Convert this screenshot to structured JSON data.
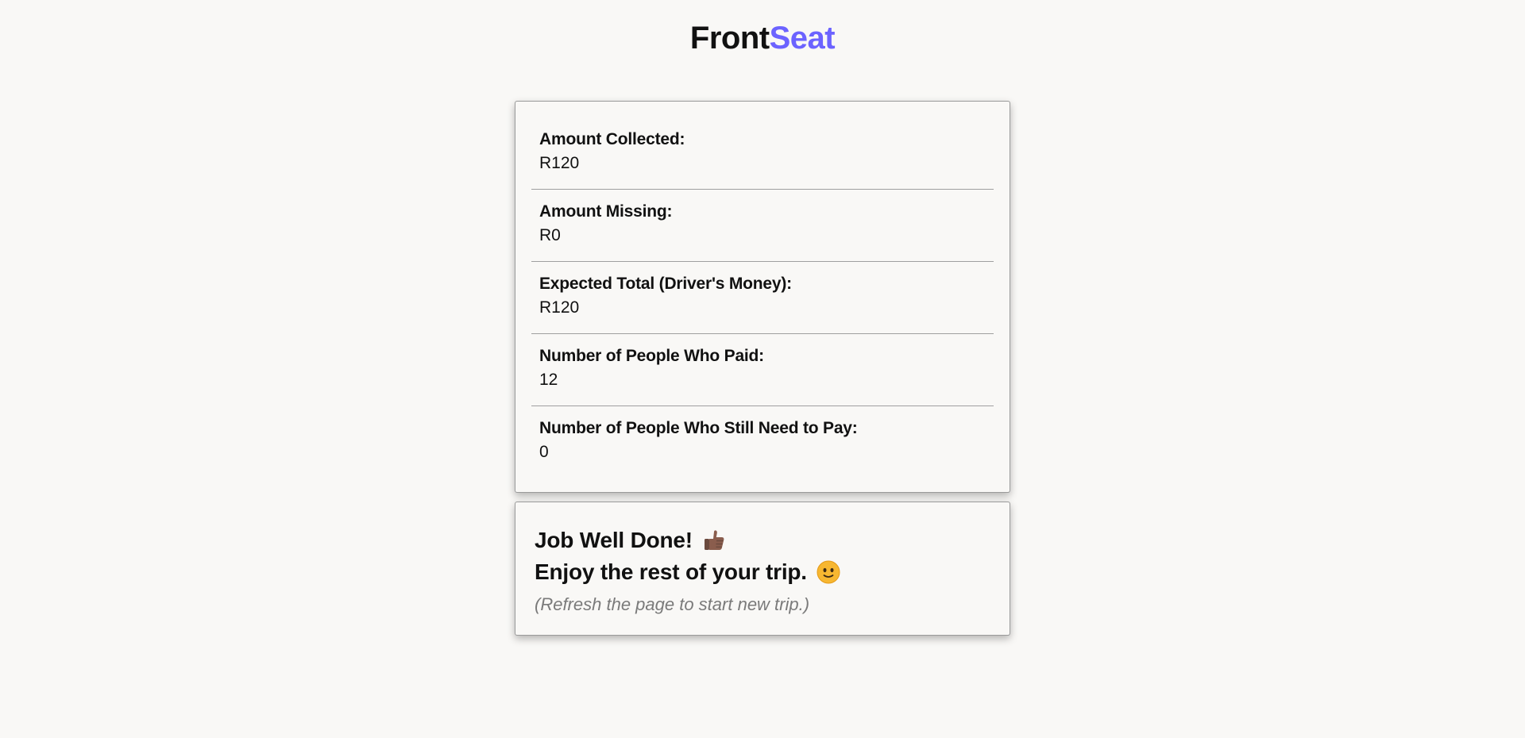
{
  "brand": {
    "name_part1": "Front",
    "name_part2": "Seat",
    "accent_color": "#6c63ff"
  },
  "summary": {
    "items": [
      {
        "label": "Amount Collected:",
        "value": "R120"
      },
      {
        "label": "Amount Missing:",
        "value": "R0"
      },
      {
        "label": "Expected Total (Driver's Money):",
        "value": "R120"
      },
      {
        "label": "Number of People Who Paid:",
        "value": "12"
      },
      {
        "label": "Number of People Who Still Need to Pay:",
        "value": "0"
      }
    ]
  },
  "completion": {
    "headline": "Job Well Done!",
    "headline_icon": "thumbs-up-icon",
    "message": "Enjoy the rest of your trip.",
    "message_icon": "smiling-face-icon",
    "hint": "(Refresh the page to start new trip.)"
  }
}
